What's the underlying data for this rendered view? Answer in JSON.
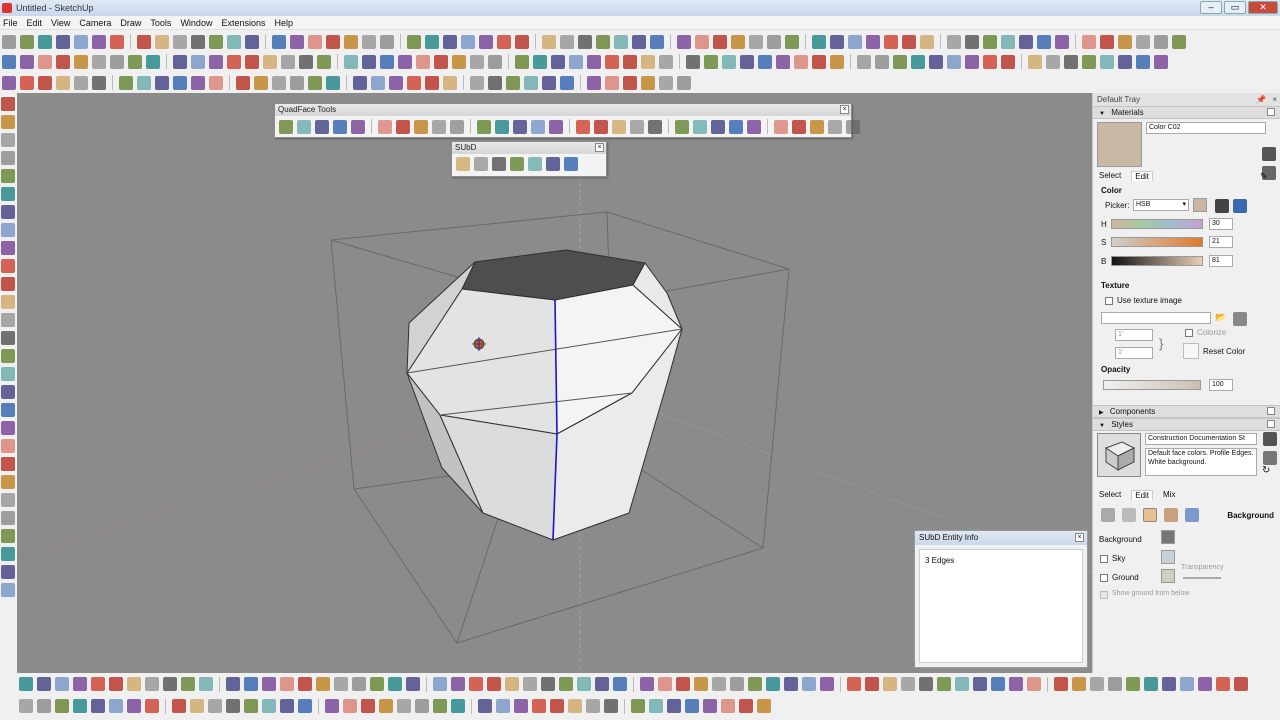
{
  "window": {
    "title": "Untitled - SketchUp"
  },
  "menu": [
    "File",
    "Edit",
    "View",
    "Camera",
    "Draw",
    "Tools",
    "Window",
    "Extensions",
    "Help"
  ],
  "quadface": {
    "title": "QuadFace Tools"
  },
  "subd": {
    "title": "SUbD"
  },
  "entity_info": {
    "title": "SUbD Entity Info",
    "text": "3 Edges"
  },
  "tray": {
    "title": "Default Tray",
    "materials": {
      "header": "Materials",
      "name": "Color C02",
      "swatch_color": "#c8b8a5",
      "tabs": [
        "Select",
        "Edit"
      ],
      "color_label": "Color",
      "picker_label": "Picker:",
      "picker_value": "HSB",
      "h_label": "H",
      "h_value": "30",
      "s_label": "S",
      "s_value": "21",
      "b_label": "B",
      "b_value": "81",
      "texture_label": "Texture",
      "use_texture_label": "Use texture image",
      "tex_w": "1'",
      "tex_h": "1'",
      "colorize_label": "Colorize",
      "reset_color_label": "Reset Color",
      "opacity_label": "Opacity",
      "opacity_value": "100"
    },
    "components_header": "Components",
    "styles": {
      "header": "Styles",
      "name": "Construction Documentation St",
      "description": "Default face colors. Profile Edges. White background.",
      "tabs": [
        "Select",
        "Edit",
        "Mix"
      ],
      "section": "Background",
      "background_label": "Background",
      "background_color": "#767676",
      "sky_label": "Sky",
      "sky_color": "#c9cfd3",
      "ground_label": "Ground",
      "ground_color": "#d1cfbf",
      "transparency_label": "Transparency",
      "show_ground_label": "Show ground from below"
    }
  },
  "viewport": {
    "background": "#8b8b8b"
  }
}
